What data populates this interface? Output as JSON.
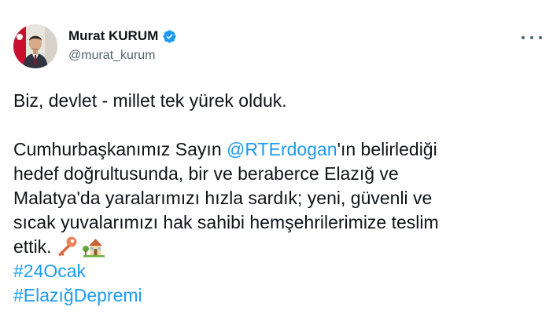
{
  "author": {
    "name": "Murat KURUM",
    "handle": "@murat_kurum",
    "verified": true
  },
  "tweet": {
    "line1": "Biz, devlet - millet tek yürek olduk.",
    "para2_prefix": "Cumhurbaşkanımız Sayın ",
    "mention": "@RTErdogan",
    "para2_suffix": "'ın belirlediği",
    "line3": "hedef doğrultusunda, bir ve beraberce Elazığ ve",
    "line4": "Malatya'da yaralarımızı hızla sardık; yeni, güvenli ve",
    "line5": "sıcak yuvalarımızı hak sahibi hemşehrilerimize teslim",
    "line6": "ettik.",
    "emojis": [
      "key-emoji",
      "house-with-garden-emoji"
    ],
    "hashtags": [
      "#24Ocak",
      "#ElazığDepremi"
    ]
  },
  "colors": {
    "link": "#1d9bf0",
    "text": "#0f1419",
    "secondary": "#536471",
    "verified": "#1d9bf0"
  },
  "icons": {
    "more": "more-horizontal-icon",
    "verified": "verified-badge-icon"
  }
}
